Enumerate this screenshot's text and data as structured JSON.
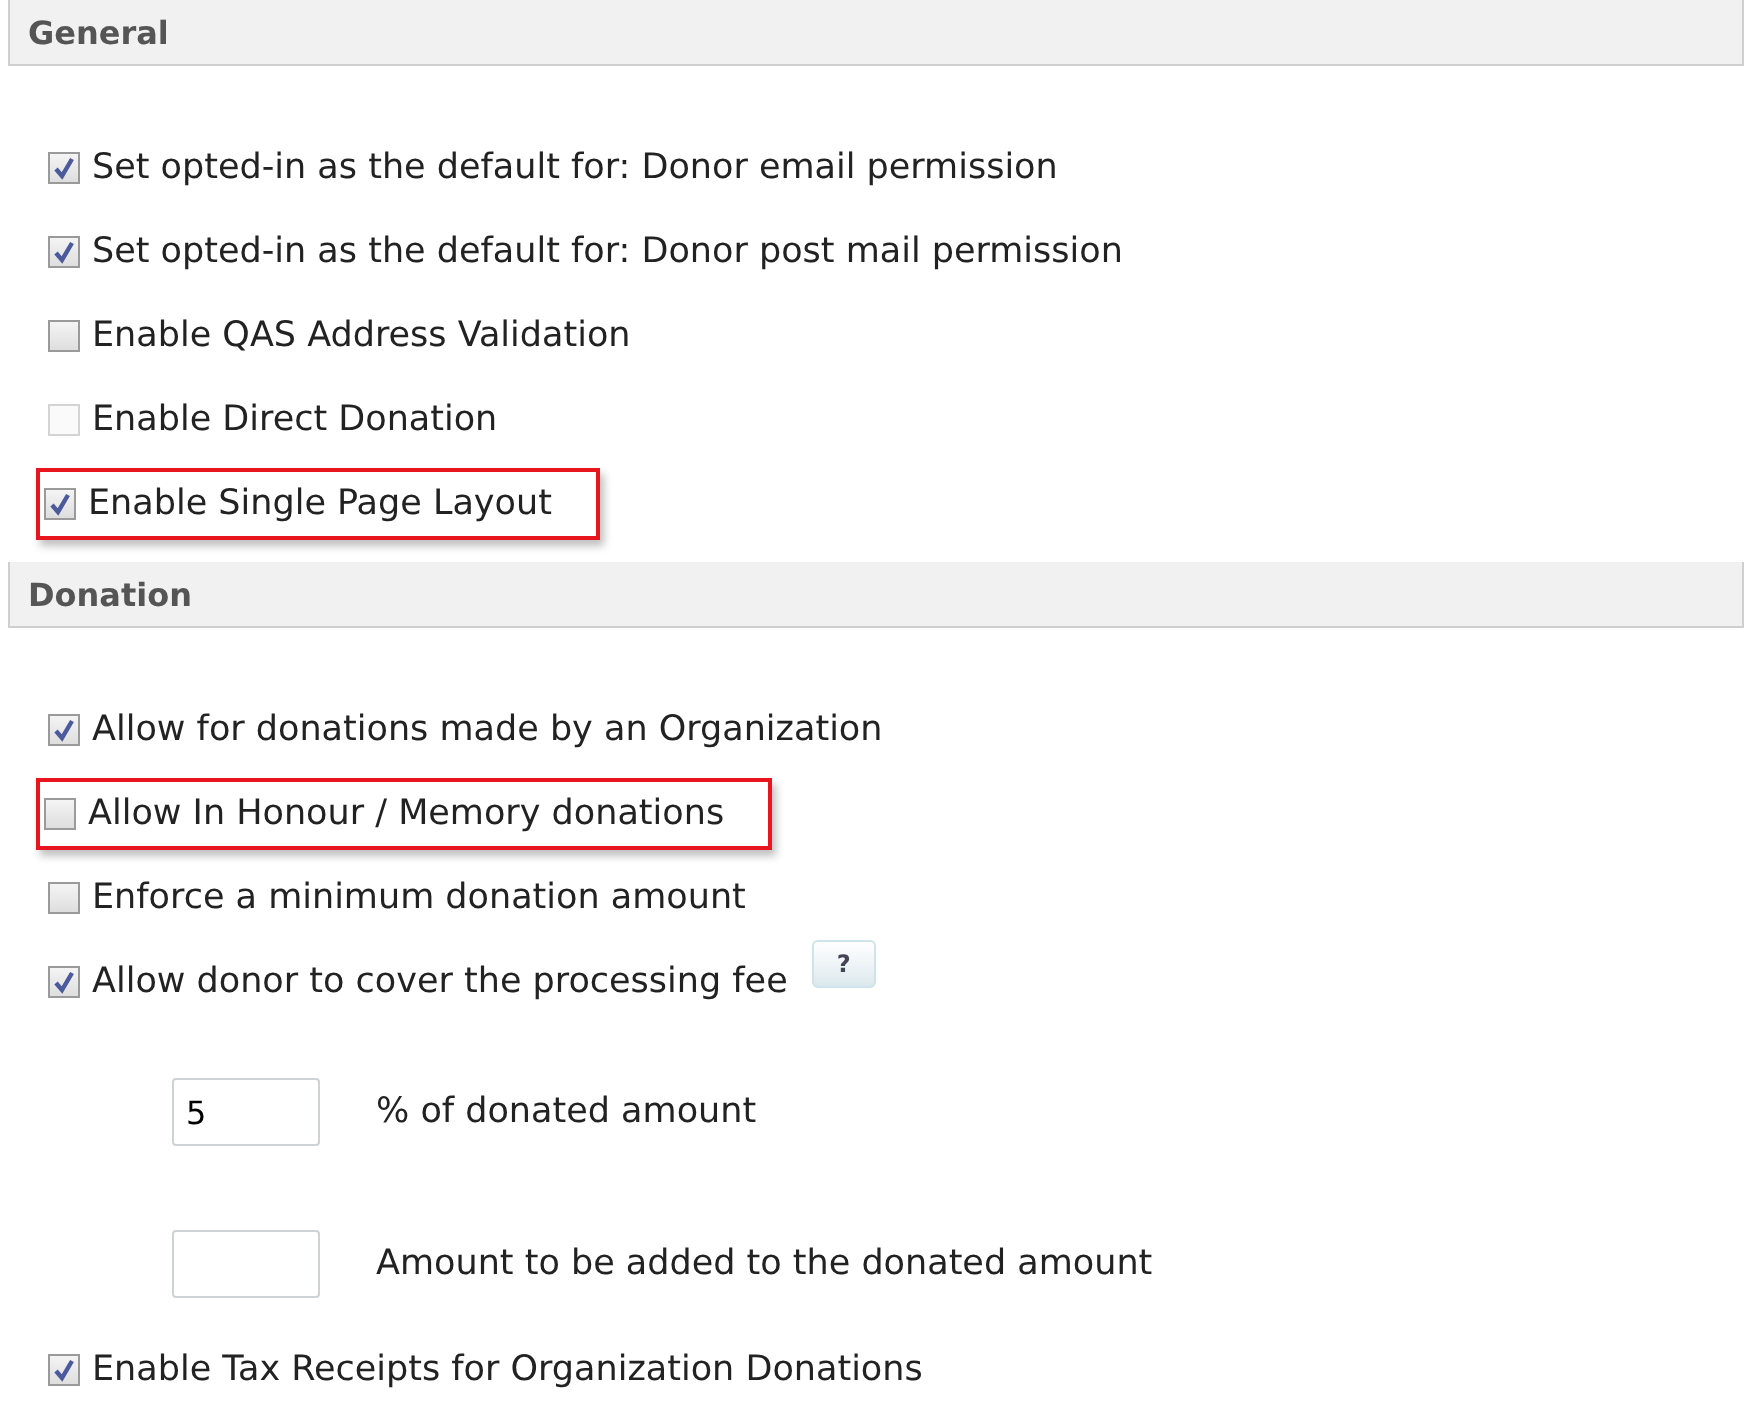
{
  "sections": [
    {
      "title": "General",
      "items": [
        {
          "kind": "checkbox",
          "label": "Set opted-in as the default for: Donor email permission",
          "checked": true,
          "disabled": false,
          "highlighted": false
        },
        {
          "kind": "checkbox",
          "label": "Set opted-in as the default for: Donor post mail permission",
          "checked": true,
          "disabled": false,
          "highlighted": false
        },
        {
          "kind": "checkbox",
          "label": "Enable QAS Address Validation",
          "checked": false,
          "disabled": false,
          "highlighted": false
        },
        {
          "kind": "checkbox",
          "label": "Enable Direct Donation",
          "checked": false,
          "disabled": true,
          "highlighted": false
        },
        {
          "kind": "checkbox",
          "label": "Enable Single Page Layout",
          "checked": true,
          "disabled": false,
          "highlighted": true
        }
      ]
    },
    {
      "title": "Donation",
      "items": [
        {
          "kind": "checkbox",
          "label": "Allow for donations made by an Organization",
          "checked": true,
          "disabled": false,
          "highlighted": false
        },
        {
          "kind": "checkbox",
          "label": "Allow In Honour / Memory donations",
          "checked": false,
          "disabled": false,
          "highlighted": true
        },
        {
          "kind": "checkbox",
          "label": "Enforce a minimum donation amount",
          "checked": false,
          "disabled": false,
          "highlighted": false
        },
        {
          "kind": "checkbox",
          "label": "Allow donor to cover the processing fee",
          "checked": true,
          "disabled": false,
          "highlighted": false,
          "help": "?"
        },
        {
          "kind": "input",
          "value": "5",
          "label": "% of donated amount"
        },
        {
          "kind": "input",
          "label": "Amount to be added to the donated amount"
        },
        {
          "kind": "checkbox",
          "label": "Enable Tax Receipts for Organization Donations",
          "checked": true,
          "disabled": false,
          "highlighted": false
        }
      ]
    }
  ]
}
